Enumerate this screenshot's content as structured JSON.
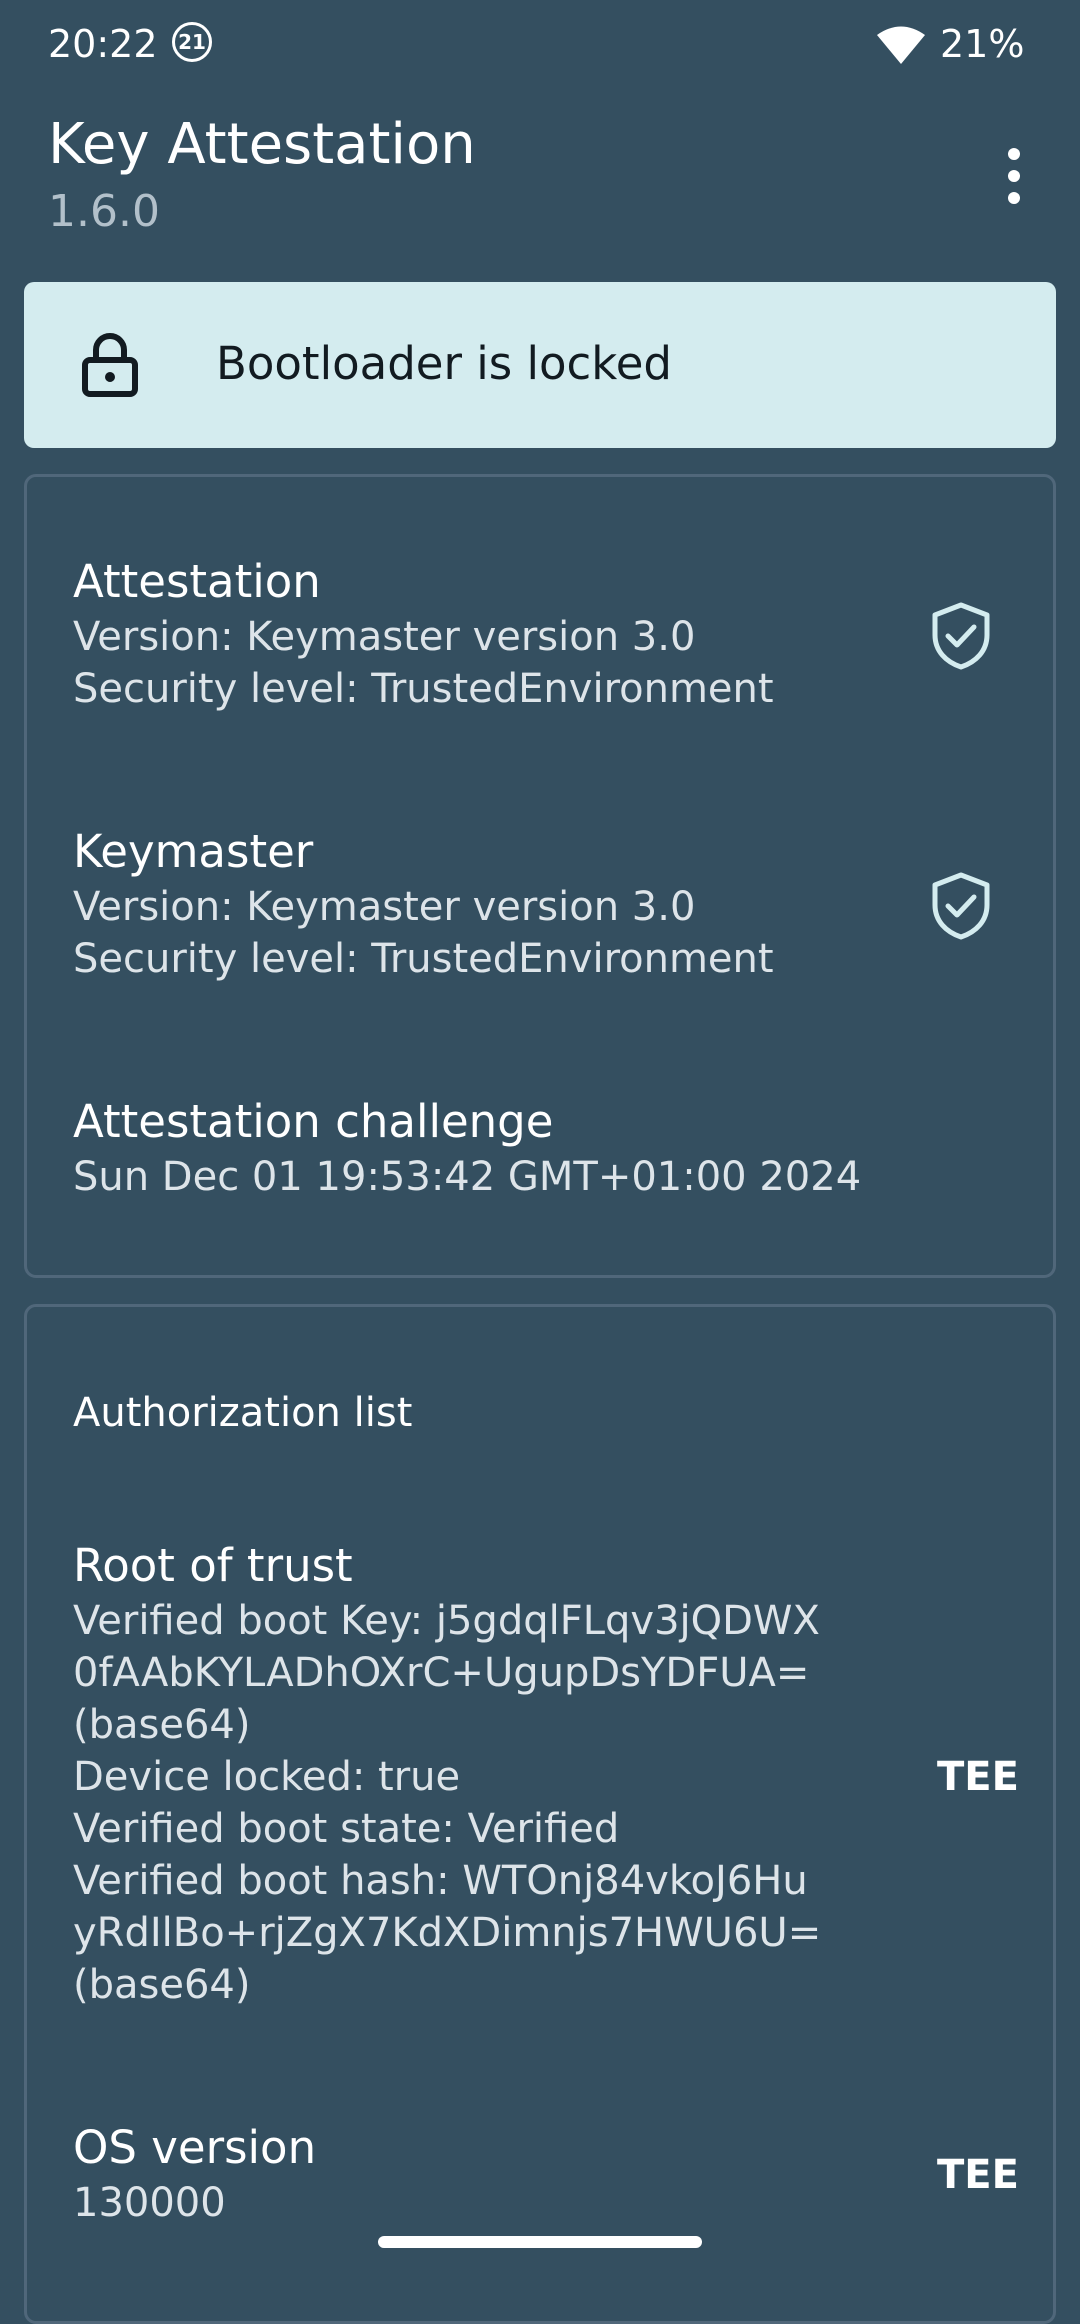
{
  "status_bar": {
    "time": "20:22",
    "notification_badge": "21",
    "battery": "21%",
    "wifi_icon": "wifi-icon"
  },
  "app_bar": {
    "title": "Key Attestation",
    "version": "1.6.0",
    "menu_icon": "more-vert-icon"
  },
  "bootloader": {
    "icon": "lock-icon",
    "text": "Bootloader is locked",
    "background": "#d4ecef"
  },
  "attestation_card": {
    "items": [
      {
        "title": "Attestation",
        "lines": [
          "Version: Keymaster version 3.0",
          "Security level: TrustedEnvironment"
        ],
        "icon": "shield-check-icon"
      },
      {
        "title": "Keymaster",
        "lines": [
          "Version: Keymaster version 3.0",
          "Security level: TrustedEnvironment"
        ],
        "icon": "shield-check-icon"
      },
      {
        "title": "Attestation challenge",
        "lines": [
          "Sun Dec 01 19:53:42 GMT+01:00 2024"
        ]
      }
    ]
  },
  "authorization_card": {
    "header": "Authorization list",
    "items": [
      {
        "title": "Root of trust",
        "lines": [
          "Verified boot Key: j5gdqlFLqv3jQDWX",
          "0fAAbKYLADhOXrC+UgupDsYDFUA=",
          "(base64)",
          "Device locked: true",
          "Verified boot state: Verified",
          "Verified boot hash: WTOnj84vkoJ6Hu",
          "yRdIlBo+rjZgX7KdXDimnjs7HWU6U=",
          "(base64)"
        ],
        "badge": "TEE"
      },
      {
        "title": "OS version",
        "lines": [
          "130000"
        ],
        "badge": "TEE"
      }
    ]
  },
  "colors": {
    "background": "#344f60",
    "card_border": "#50677a",
    "secondary_text": "#b2c0ca",
    "shield": "#d4ecef"
  }
}
